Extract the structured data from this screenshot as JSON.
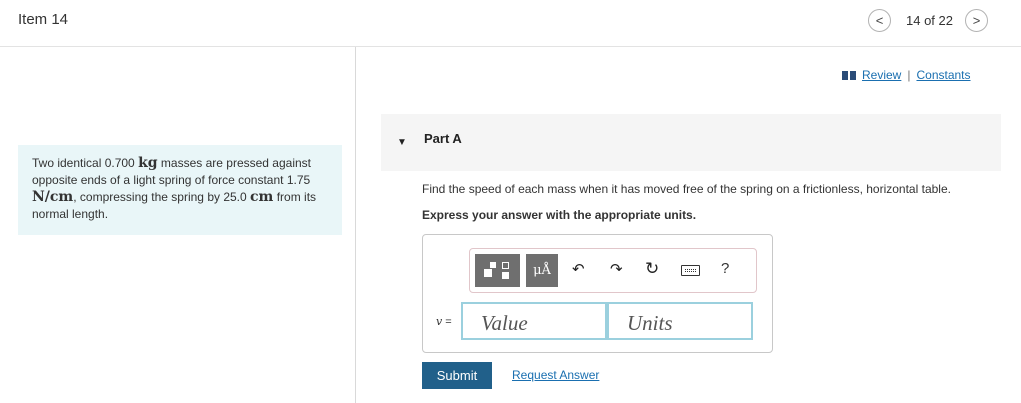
{
  "header": {
    "item_title": "Item 14",
    "counter": "14 of 22",
    "prev_symbol": "<",
    "next_symbol": ">"
  },
  "resources": {
    "review_label": "Review",
    "separator": "|",
    "constants_label": "Constants",
    "icon": "book-icon",
    "icon_color": "#2a4c78"
  },
  "problem": {
    "t1": "Two identical 0.700 ",
    "m1": "kg",
    "t2": " masses are pressed against opposite ends of a light spring of force constant 1.75 ",
    "m2": "N/cm",
    "t3": ", compressing the spring by 25.0 ",
    "m3": "cm",
    "t4": " from its normal length."
  },
  "part": {
    "label": "Part A",
    "caret_symbol": "▼",
    "question": "Find the speed of each mass when it has moved free of the spring on a frictionless, horizontal table.",
    "instruction": "Express your answer with the appropriate units."
  },
  "toolbar": {
    "mu_label": "μÅ",
    "undo_icon": "↶",
    "redo_icon": "↷",
    "reset_icon": "↻",
    "help_label": "?"
  },
  "answer": {
    "variable": "v",
    "equals": "=",
    "value_placeholder": "Value",
    "units_placeholder": "Units"
  },
  "actions": {
    "submit_label": "Submit",
    "request_label": "Request Answer"
  },
  "colors": {
    "accent": "#21608a",
    "link": "#1a6fb0",
    "problem_bg": "#e9f6f8",
    "input_border": "#9bd0de"
  }
}
